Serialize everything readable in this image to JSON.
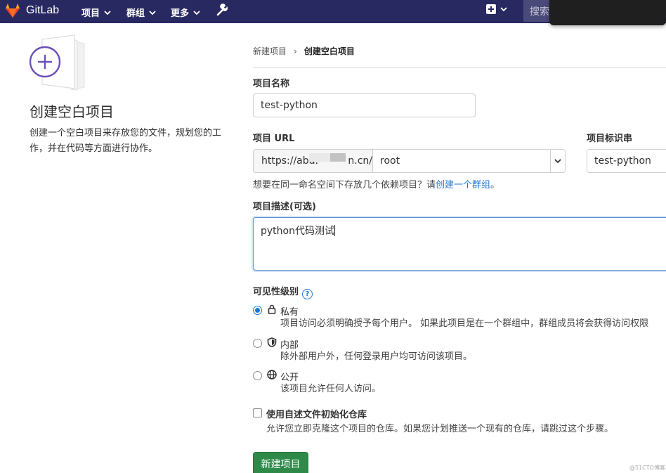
{
  "navbar": {
    "brand": "GitLab",
    "items": [
      {
        "label": "项目"
      },
      {
        "label": "群组"
      },
      {
        "label": "更多"
      }
    ],
    "search_placeholder": "搜索"
  },
  "left": {
    "title": "创建空白项目",
    "description": "创建一个空白项目来存放您的文件，规划您的工作，并在代码等方面进行协作。"
  },
  "breadcrumb": {
    "parent": "新建项目",
    "separator": "›",
    "current": "创建空白项目"
  },
  "form": {
    "name_label": "项目名称",
    "name_value": "test-python",
    "url_label": "项目 URL",
    "url_prefix": "https://abd.",
    "url_suffix": "n.cn/",
    "namespace_value": "root",
    "slug_label": "项目标识串",
    "slug_value": "test-python",
    "hint_text": "想要在同一命名空间下存放几个依赖项目？请",
    "hint_link": "创建一个群组",
    "hint_end": "。",
    "desc_label": "项目描述(可选)",
    "desc_value": "python代码测试",
    "visibility_label": "可见性级别",
    "visibility": [
      {
        "title": "私有",
        "desc": "项目访问必须明确授予每个用户。 如果此项目是在一个群组中，群组成员将会获得访问权限",
        "selected": true,
        "icon": "lock-icon"
      },
      {
        "title": "内部",
        "desc": "除外部用户外，任何登录用户均可访问该项目。",
        "selected": false,
        "icon": "shield-icon"
      },
      {
        "title": "公开",
        "desc": "该项目允许任何人访问。",
        "selected": false,
        "icon": "globe-icon"
      }
    ],
    "readme_label": "使用自述文件初始化仓库",
    "readme_desc": "允许您立即克隆这个项目的仓库。如果您计划推送一个现有的仓库，请跳过这个步骤。",
    "submit_label": "新建项目"
  },
  "watermark": "@51CTO博客",
  "colors": {
    "navbar": "#292961",
    "primary_blue": "#1f78d1",
    "submit_green": "#2f8a4a",
    "illustration_purple": "#6b4fbb"
  }
}
